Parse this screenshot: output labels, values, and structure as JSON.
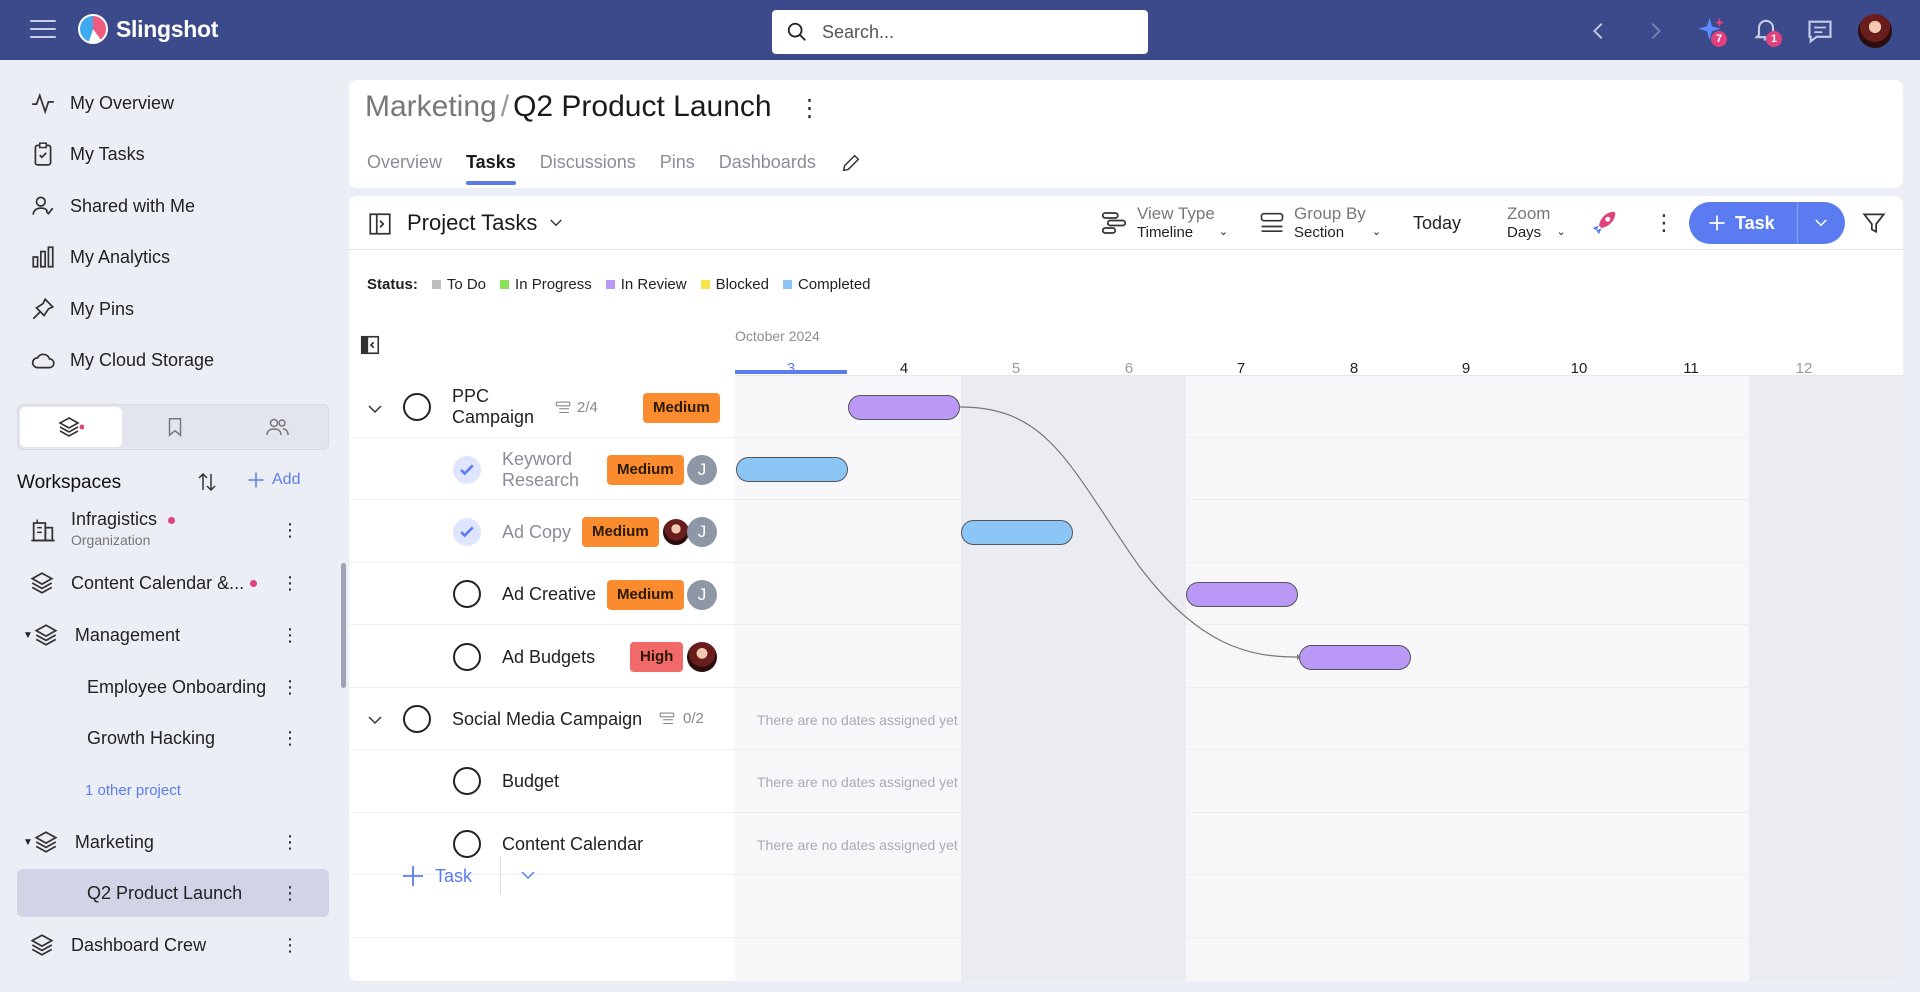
{
  "app": {
    "name": "Slingshot"
  },
  "search": {
    "placeholder": "Search..."
  },
  "topbar": {
    "ai_badge": "7",
    "notif_badge": "1"
  },
  "nav": [
    {
      "label": "My Overview",
      "icon": "activity-icon"
    },
    {
      "label": "My Tasks",
      "icon": "clipboard-check-icon"
    },
    {
      "label": "Shared with Me",
      "icon": "user-check-icon"
    },
    {
      "label": "My Analytics",
      "icon": "bar-chart-icon"
    },
    {
      "label": "My Pins",
      "icon": "pin-icon"
    },
    {
      "label": "My Cloud Storage",
      "icon": "cloud-icon"
    }
  ],
  "workspaces": {
    "title": "Workspaces",
    "add_label": "Add",
    "items": [
      {
        "label": "Infragistics",
        "sub": "Organization"
      },
      {
        "label": "Content Calendar &..."
      },
      {
        "label": "Management"
      },
      {
        "label": "Employee Onboarding"
      },
      {
        "label": "Growth Hacking"
      },
      {
        "label": "1 other project"
      },
      {
        "label": "Marketing"
      },
      {
        "label": "Q2 Product Launch"
      },
      {
        "label": "Dashboard Crew"
      }
    ]
  },
  "project": {
    "parent": "Marketing",
    "separator": "/",
    "name": "Q2 Product Launch",
    "tabs": [
      "Overview",
      "Tasks",
      "Discussions",
      "Pins",
      "Dashboards"
    ]
  },
  "toolbar": {
    "title": "Project Tasks",
    "view_type_label": "View Type",
    "view_type_value": "Timeline",
    "group_by_label": "Group By",
    "group_by_value": "Section",
    "today": "Today",
    "zoom_label": "Zoom",
    "zoom_value": "Days",
    "task_button": "Task"
  },
  "legend": {
    "label": "Status:",
    "items": [
      {
        "label": "To Do",
        "color": "#bdbdbd"
      },
      {
        "label": "In Progress",
        "color": "#8ee05a"
      },
      {
        "label": "In Review",
        "color": "#b999f5"
      },
      {
        "label": "Blocked",
        "color": "#f5e44a"
      },
      {
        "label": "Completed",
        "color": "#8cc6f7"
      }
    ]
  },
  "timeline": {
    "month": "October 2024",
    "days": [
      "3",
      "4",
      "5",
      "6",
      "7",
      "8",
      "9",
      "10",
      "11",
      "12"
    ]
  },
  "sections": [
    {
      "name": "PPC Campaign",
      "progress": "2/4",
      "priority": "Medium"
    },
    {
      "name": "Social Media Campaign",
      "progress": "0/2"
    }
  ],
  "tasks": [
    {
      "name": "Keyword Research",
      "priority": "Medium",
      "assignee": "J"
    },
    {
      "name": "Ad Copy",
      "priority": "Medium",
      "assignee": "J"
    },
    {
      "name": "Ad Creative",
      "priority": "Medium",
      "assignee": "J"
    },
    {
      "name": "Ad Budgets",
      "priority": "High"
    },
    {
      "name": "Budget"
    },
    {
      "name": "Content Calendar"
    }
  ],
  "no_dates": "There are no dates assigned yet",
  "add_task": "Task",
  "colors": {
    "accent": "#5b7cf0",
    "topbar": "#3b4a8a",
    "in_review": "#b999f5",
    "completed": "#8cc6f7"
  }
}
